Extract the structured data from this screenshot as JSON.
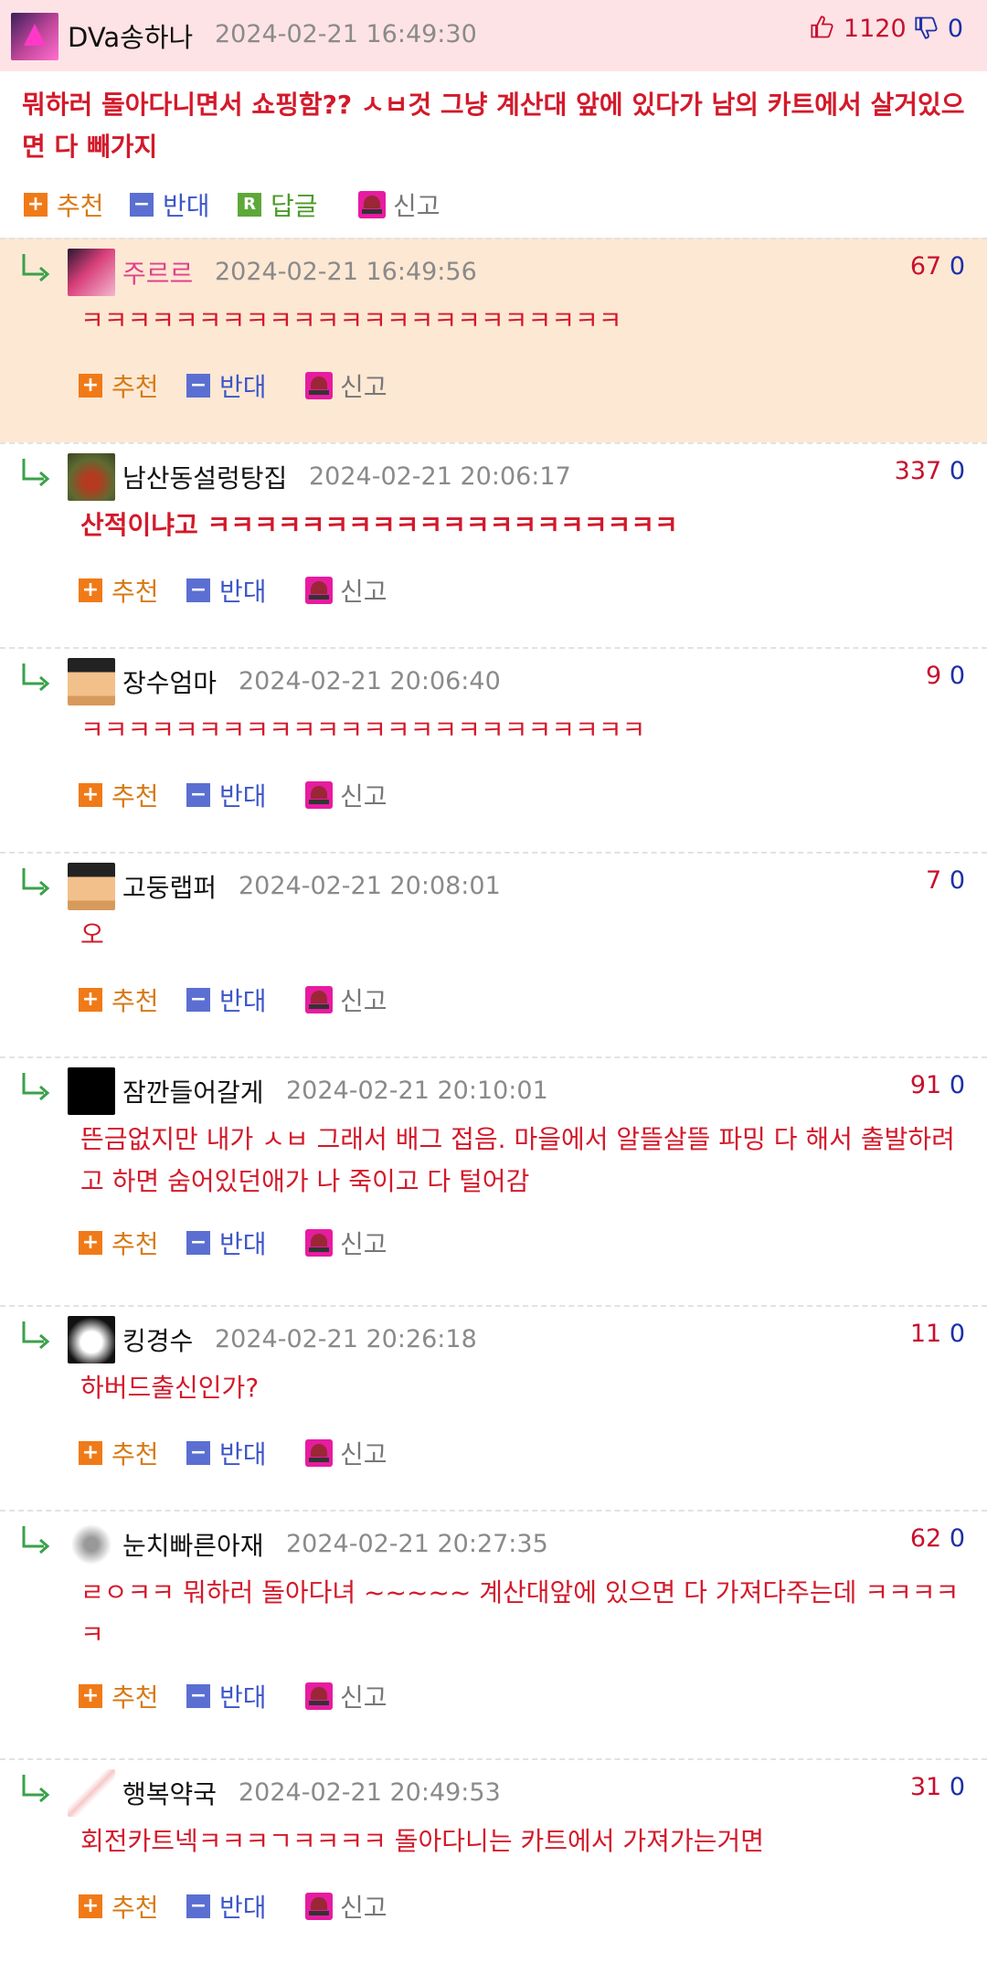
{
  "post": {
    "nickname": "DVa송하나",
    "date": "2024-02-21 16:49:30",
    "up": "1120",
    "down": "0",
    "body": "뭐하러 돌아다니면서 쇼핑함?? ㅅㅂ것 그냥 계산대 앞에 있다가 남의 카트에서 살거있으면 다 빼가지",
    "actions": {
      "recommend": "추천",
      "oppose": "반대",
      "reply": "답글",
      "report": "신고",
      "reply_badge": "R"
    }
  },
  "labels": {
    "recommend": "추천",
    "oppose": "반대",
    "report": "신고",
    "plus": "+",
    "minus": "−"
  },
  "comments": [
    {
      "nickname": "주르르",
      "date": "2024-02-21 16:49:56",
      "up": "67",
      "down": "0",
      "text": "ㅋㅋㅋㅋㅋㅋㅋㅋㅋㅋㅋㅋㅋㅋㅋㅋㅋㅋㅋㅋㅋㅋㅋ",
      "highlighted": true,
      "nick_color": "#e0428a"
    },
    {
      "nickname": "남산동설렁탕집",
      "date": "2024-02-21 20:06:17",
      "up": "337",
      "down": "0",
      "text": "산적이냐고 ㅋㅋㅋㅋㅋㅋㅋㅋㅋㅋㅋㅋㅋㅋㅋㅋㅋㅋㅋㅋ",
      "bold": true
    },
    {
      "nickname": "장수엄마",
      "date": "2024-02-21 20:06:40",
      "up": "9",
      "down": "0",
      "text": "ㅋㅋㅋㅋㅋㅋㅋㅋㅋㅋㅋㅋㅋㅋㅋㅋㅋㅋㅋㅋㅋㅋㅋㅋ"
    },
    {
      "nickname": "고둥랩퍼",
      "date": "2024-02-21 20:08:01",
      "up": "7",
      "down": "0",
      "text": "오"
    },
    {
      "nickname": "잠깐들어갈게",
      "date": "2024-02-21 20:10:01",
      "up": "91",
      "down": "0",
      "text": "뜬금없지만 내가 ㅅㅂ 그래서 배그 접음. 마을에서 알뜰살뜰 파밍 다 해서 출발하려고 하면 숨어있던애가 나 죽이고 다 털어감"
    },
    {
      "nickname": "킹경수",
      "date": "2024-02-21 20:26:18",
      "up": "11",
      "down": "0",
      "text": "하버드출신인가?"
    },
    {
      "nickname": "눈치빠른아재",
      "date": "2024-02-21 20:27:35",
      "up": "62",
      "down": "0",
      "text": "ㄹㅇㅋㅋ 뭐하러 돌아다녀 ~~~~~ 계산대앞에 있으면 다 가져다주는데 ㅋㅋㅋㅋㅋ"
    },
    {
      "nickname": "행복약국",
      "date": "2024-02-21 20:49:53",
      "up": "31",
      "down": "0",
      "text": "회전카트넥ㅋㅋㅋㄱㅋㅋㅋㅋ 돌아다니는 카트에서 가져가는거면"
    }
  ]
}
